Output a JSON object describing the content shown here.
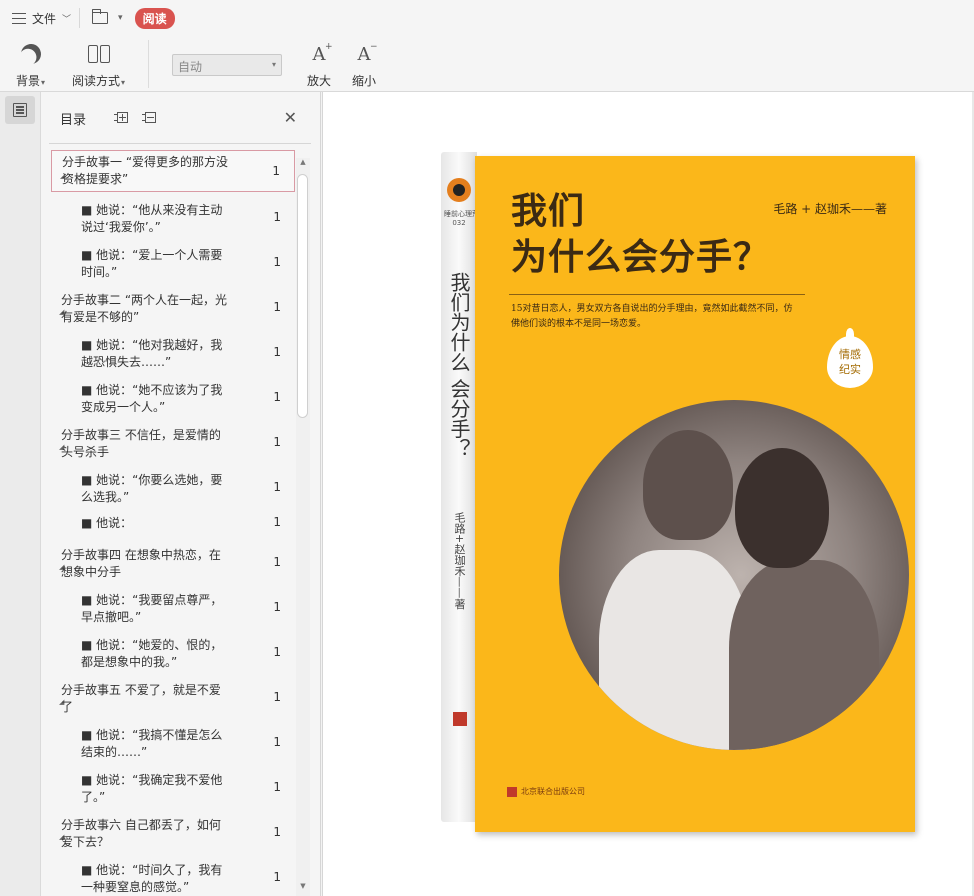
{
  "menubar": {
    "file_label": "文件",
    "read_badge": "阅读"
  },
  "ribbon": {
    "background_label": "背景",
    "read_mode_label": "阅读方式",
    "zoom_value": "自动",
    "zoom_in_label": "放大",
    "zoom_out_label": "缩小"
  },
  "toc": {
    "title": "目录",
    "items": [
      {
        "level": 1,
        "text": "分手故事一 “爱得更多的那方没资格提要求”",
        "page": "1"
      },
      {
        "level": 2,
        "text": "■ 她说：“他从来没有主动说过‘我爱你’。”",
        "page": "1"
      },
      {
        "level": 2,
        "text": "■ 他说：“爱上一个人需要时间。”",
        "page": "1"
      },
      {
        "level": 1,
        "text": "分手故事二 “两个人在一起，光有爱是不够的”",
        "page": "1"
      },
      {
        "level": 2,
        "text": "■ 她说：“他对我越好，我越恐惧失去……”",
        "page": "1"
      },
      {
        "level": 2,
        "text": "■ 他说：“她不应该为了我变成另一个人。”",
        "page": "1"
      },
      {
        "level": 1,
        "text": "分手故事三 不信任，是爱情的头号杀手",
        "page": "1"
      },
      {
        "level": 2,
        "text": "■ 她说：“你要么选她，要么选我。”",
        "page": "1"
      },
      {
        "level": 2,
        "text": "■ 他说：",
        "page": "1"
      },
      {
        "level": 1,
        "text": "分手故事四 在想象中热恋，在想象中分手",
        "page": "1"
      },
      {
        "level": 2,
        "text": "■ 她说：“我要留点尊严，早点撤吧。”",
        "page": "1"
      },
      {
        "level": 2,
        "text": "■ 他说：“她爱的、恨的，都是想象中的我。”",
        "page": "1"
      },
      {
        "level": 1,
        "text": "分手故事五 不爱了，就是不爱了",
        "page": "1"
      },
      {
        "level": 2,
        "text": "■ 他说：“我搞不懂是怎么结束的……”",
        "page": "1"
      },
      {
        "level": 2,
        "text": "■ 她说：“我确定我不爱他了。”",
        "page": "1"
      },
      {
        "level": 1,
        "text": "分手故事六 自己都丢了，如何爱下去？",
        "page": "1"
      },
      {
        "level": 2,
        "text": "■ 他说：“时间久了，我有一种要窒息的感觉。”",
        "page": "1"
      }
    ]
  },
  "book": {
    "title": "我们\n为什么会分手？",
    "spine_title": "我们为什么 会分手？",
    "spine_series": "睡前心理荒\n032",
    "author": "毛路 + 赵珈禾——著",
    "spine_author": "毛路+赵珈禾——著",
    "description": "15对昔日恋人，男女双方各自说出的分手理由，竟然如此截然不同，仿佛他们谈的根本不是同一场恋爱。",
    "tag": "情感\n纪实",
    "publisher": "北京联合出版公司"
  },
  "colors": {
    "accent": "#d9534f",
    "cover": "#fbb71a",
    "selection_border": "#d99aa4"
  },
  "icons": [
    "menu-icon",
    "folder-icon",
    "moon-icon",
    "book-icon",
    "font-increase-icon",
    "font-decrease-icon",
    "toc-icon",
    "expand-all-icon",
    "collapse-all-icon",
    "close-icon"
  ]
}
